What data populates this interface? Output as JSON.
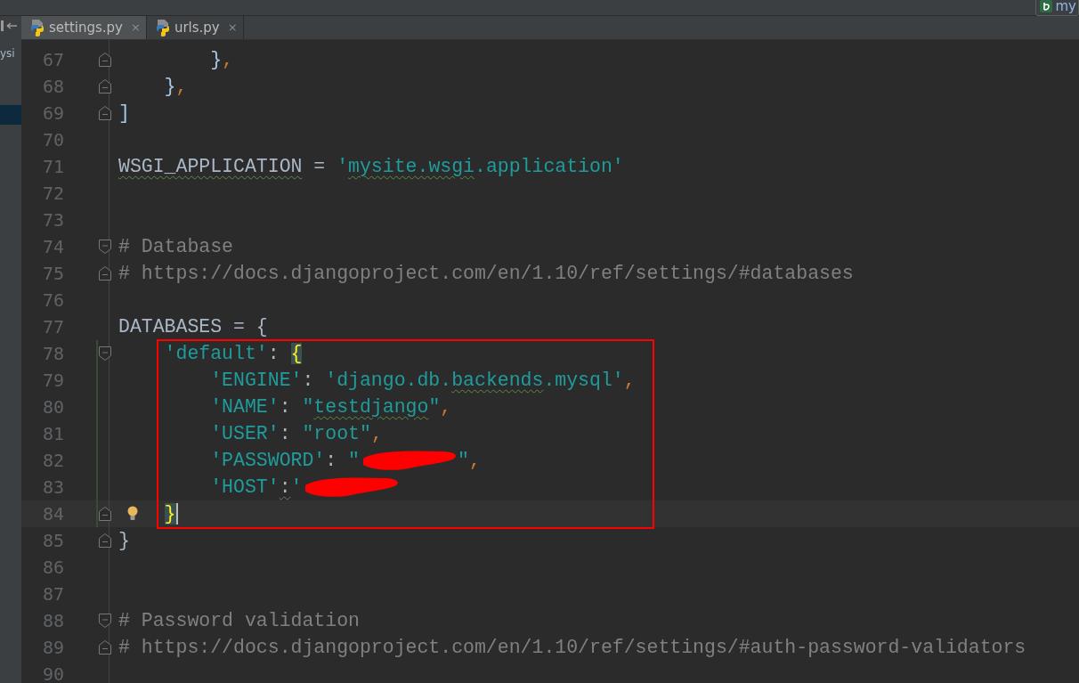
{
  "project_panel": {
    "label": "ysi"
  },
  "toolbar": {
    "project_label": "my"
  },
  "tabs": [
    {
      "label": "settings.py",
      "close": "×",
      "selected": true
    },
    {
      "label": "urls.py",
      "close": "×",
      "selected": false
    }
  ],
  "lines": [
    {
      "number": "67",
      "fold_start": false,
      "fold_end": true,
      "changed": false,
      "current": false,
      "tokens": [
        {
          "kind": "brace",
          "text": "        }"
        },
        {
          "kind": "punct",
          "text": ","
        }
      ]
    },
    {
      "number": "68",
      "fold_start": false,
      "fold_end": true,
      "changed": false,
      "current": false,
      "tokens": [
        {
          "kind": "brace",
          "text": "    }"
        },
        {
          "kind": "punct",
          "text": ","
        }
      ]
    },
    {
      "number": "69",
      "fold_start": false,
      "fold_end": true,
      "changed": false,
      "current": false,
      "tokens": [
        {
          "kind": "brace",
          "text": "]"
        }
      ]
    },
    {
      "number": "70",
      "fold_start": false,
      "fold_end": false,
      "changed": false,
      "current": false
    },
    {
      "number": "71",
      "fold_start": false,
      "fold_end": false,
      "changed": false,
      "current": false,
      "tokens": [
        {
          "kind": "plain",
          "text": "WSGI_APPLICATION",
          "flagged": true
        },
        {
          "kind": "plain",
          "text": " = "
        },
        {
          "kind": "string",
          "text": "'"
        },
        {
          "kind": "string",
          "text": "mysite.wsgi",
          "flagged": true
        },
        {
          "kind": "string",
          "text": ".application'"
        }
      ]
    },
    {
      "number": "72",
      "fold_start": false,
      "fold_end": false,
      "changed": false,
      "current": false
    },
    {
      "number": "73",
      "fold_start": false,
      "fold_end": false,
      "changed": false,
      "current": false
    },
    {
      "number": "74",
      "fold_start": true,
      "fold_end": false,
      "changed": false,
      "current": false,
      "tokens": [
        {
          "kind": "comment",
          "text": "# Database"
        }
      ]
    },
    {
      "number": "75",
      "fold_start": false,
      "fold_end": true,
      "changed": false,
      "current": false,
      "tokens": [
        {
          "kind": "comment",
          "text": "# https://docs.djangoproject.com/en/1.10/ref/settings/#databases"
        }
      ]
    },
    {
      "number": "76",
      "fold_start": false,
      "fold_end": false,
      "changed": false,
      "current": false
    },
    {
      "number": "77",
      "fold_start": false,
      "fold_end": false,
      "changed": false,
      "current": false,
      "tokens": [
        {
          "kind": "plain",
          "text": "DATABASES = {"
        }
      ]
    },
    {
      "number": "78",
      "fold_start": true,
      "fold_end": false,
      "changed": true,
      "current": false,
      "tokens": [
        {
          "kind": "string",
          "text": "    'default'"
        },
        {
          "kind": "plain",
          "text": ": "
        },
        {
          "kind": "match",
          "text": "{"
        }
      ]
    },
    {
      "number": "79",
      "fold_start": false,
      "fold_end": false,
      "changed": true,
      "current": false,
      "tokens": [
        {
          "kind": "string",
          "text": "        'ENGINE'"
        },
        {
          "kind": "plain",
          "text": ": "
        },
        {
          "kind": "string",
          "text": "'django.db."
        },
        {
          "kind": "string",
          "text": "backends",
          "flagged": true
        },
        {
          "kind": "string",
          "text": ".mysql'"
        },
        {
          "kind": "punct",
          "text": ","
        }
      ]
    },
    {
      "number": "80",
      "fold_start": false,
      "fold_end": false,
      "changed": true,
      "current": false,
      "tokens": [
        {
          "kind": "string",
          "text": "        'NAME'"
        },
        {
          "kind": "plain",
          "text": ": "
        },
        {
          "kind": "string",
          "text": "\""
        },
        {
          "kind": "string",
          "text": "testdjango",
          "flagged": true
        },
        {
          "kind": "string",
          "text": "\""
        },
        {
          "kind": "punct",
          "text": ","
        }
      ]
    },
    {
      "number": "81",
      "fold_start": false,
      "fold_end": false,
      "changed": true,
      "current": false,
      "tokens": [
        {
          "kind": "string",
          "text": "        'USER'"
        },
        {
          "kind": "plain",
          "text": ": "
        },
        {
          "kind": "string",
          "text": "\"root\""
        },
        {
          "kind": "punct",
          "text": ","
        }
      ]
    },
    {
      "number": "82",
      "fold_start": false,
      "fold_end": false,
      "changed": true,
      "current": false,
      "tokens": [
        {
          "kind": "string",
          "text": "        'PASSWORD'"
        },
        {
          "kind": "plain",
          "text": ": "
        },
        {
          "kind": "string",
          "text": "\""
        },
        {
          "kind": "redacted"
        },
        {
          "kind": "string",
          "text": "\""
        },
        {
          "kind": "punct",
          "text": ","
        }
      ]
    },
    {
      "number": "83",
      "fold_start": false,
      "fold_end": false,
      "changed": true,
      "current": false,
      "tokens": [
        {
          "kind": "string",
          "text": "        'HOST'"
        },
        {
          "kind": "plain",
          "text": ":",
          "flagged": true
        },
        {
          "kind": "string",
          "text": "'"
        },
        {
          "kind": "redacted"
        }
      ]
    },
    {
      "number": "84",
      "fold_start": false,
      "fold_end": true,
      "changed": true,
      "current": true,
      "tokens": [
        {
          "kind": "match",
          "text": "    }"
        }
      ]
    },
    {
      "number": "85",
      "fold_start": false,
      "fold_end": true,
      "changed": false,
      "current": false,
      "tokens": [
        {
          "kind": "plain",
          "text": "}"
        }
      ]
    },
    {
      "number": "86",
      "fold_start": false,
      "fold_end": false,
      "changed": false,
      "current": false
    },
    {
      "number": "87",
      "fold_start": false,
      "fold_end": false,
      "changed": false,
      "current": false
    },
    {
      "number": "88",
      "fold_start": true,
      "fold_end": false,
      "changed": false,
      "current": false,
      "tokens": [
        {
          "kind": "comment",
          "text": "# Password validation"
        }
      ]
    },
    {
      "number": "89",
      "fold_start": false,
      "fold_end": true,
      "changed": false,
      "current": false,
      "tokens": [
        {
          "kind": "comment",
          "text": "# https://docs.djangoproject.com/en/1.10/ref/settings/#auth-password-validators"
        }
      ]
    },
    {
      "number": "90",
      "fold_start": false,
      "fold_end": false,
      "changed": false,
      "current": false
    }
  ]
}
